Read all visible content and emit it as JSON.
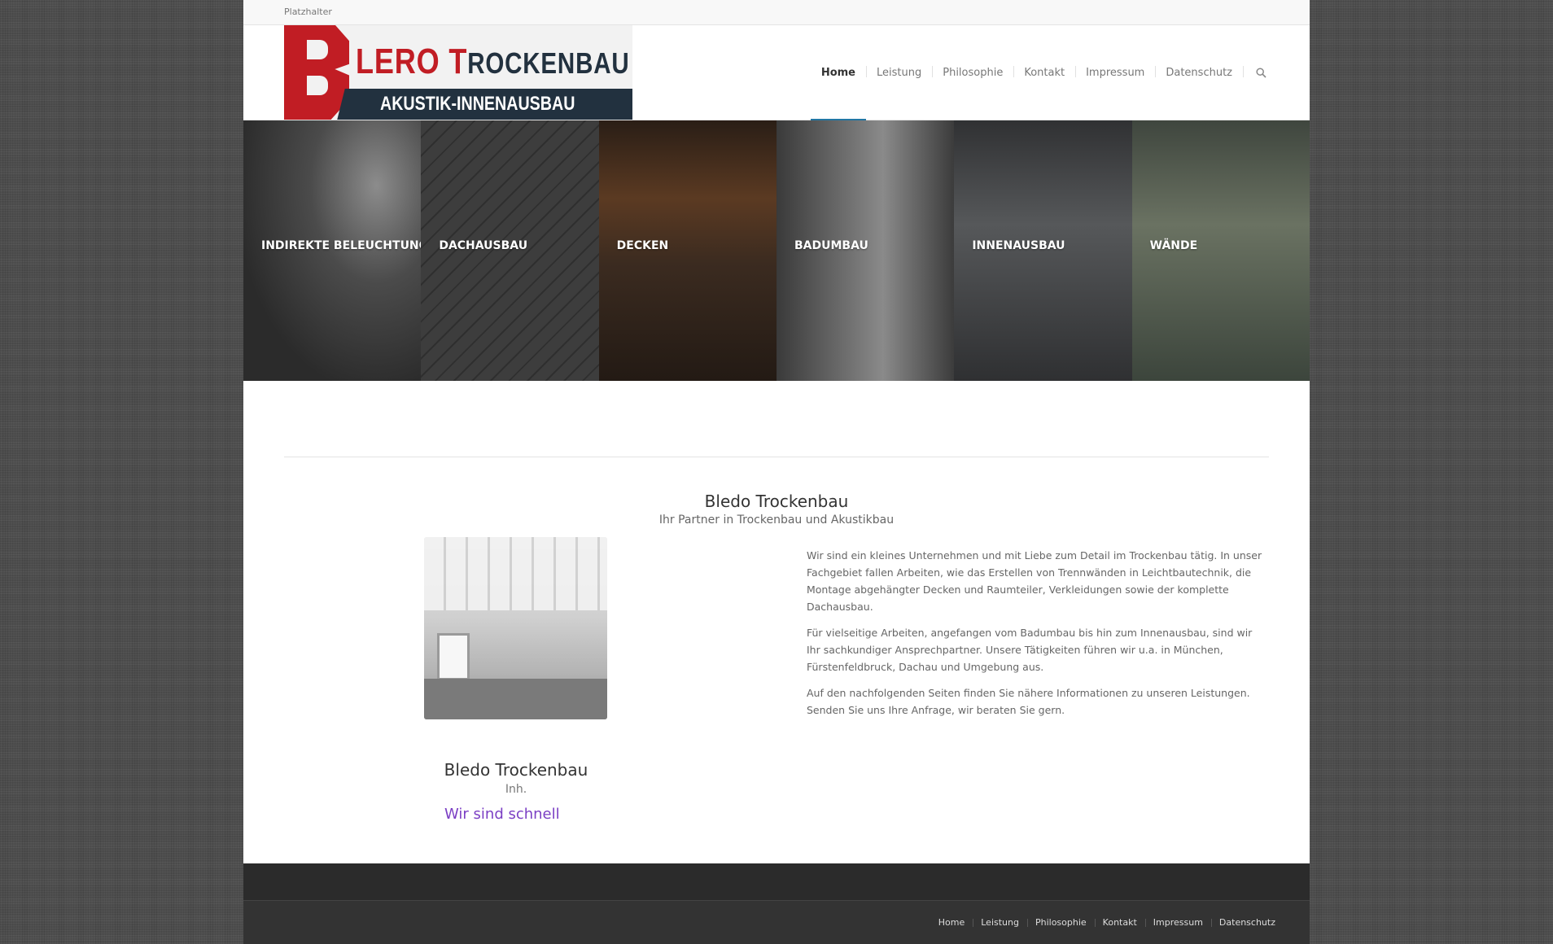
{
  "topbar": {
    "text": "Platzhalter"
  },
  "logo": {
    "big_letter": "B",
    "line1_a": "LERO ",
    "line1_b": "T",
    "line1_c": "ROCKENBAU",
    "line2": "AKUSTIK-INNENAUSBAU"
  },
  "nav": {
    "items": [
      "Home",
      "Leistung",
      "Philosophie",
      "Kontakt",
      "Impressum",
      "Datenschutz"
    ],
    "active": "Home"
  },
  "tiles": [
    "INDIREKTE BELEUCHTUNG",
    "DACHAUSBAU",
    "DECKEN",
    "BADUMBAU",
    "INNENAUSBAU",
    "WÄNDE"
  ],
  "intro": {
    "title": "Bledo Trockenbau",
    "subtitle": "Ihr Partner in Trockenbau und Akustikbau"
  },
  "profile": {
    "name": "Bledo Trockenbau",
    "role": "Inh.",
    "slogan": "Wir sind schnell"
  },
  "copy": [
    "Wir sind ein kleines Unternehmen und mit Liebe zum Detail im Trockenbau tätig. In unser Fachgebiet fallen Arbeiten, wie das Erstellen von Trennwänden in Leichtbautechnik, die Montage abgehängter Decken und Raumteiler, Verkleidungen sowie der komplette Dachausbau.",
    "Für vielseitige Arbeiten, angefangen vom Badumbau bis hin zum Innenausbau, sind wir Ihr sachkundiger Ansprechpartner. Unsere Tätigkeiten führen wir u.a. in München, Fürstenfeldbruck, Dachau und Umgebung aus.",
    "Auf den nachfolgenden Seiten finden Sie nähere Informationen zu unseren Leistungen. Senden Sie uns Ihre Anfrage, wir beraten Sie gern."
  ],
  "footer": {
    "items": [
      "Home",
      "Leistung",
      "Philosophie",
      "Kontakt",
      "Impressum",
      "Datenschutz"
    ]
  },
  "colors": {
    "accent": "#2276a3",
    "brand_red": "#c11d24",
    "brand_navy": "#22313f",
    "slogan": "#7b3fc4"
  }
}
